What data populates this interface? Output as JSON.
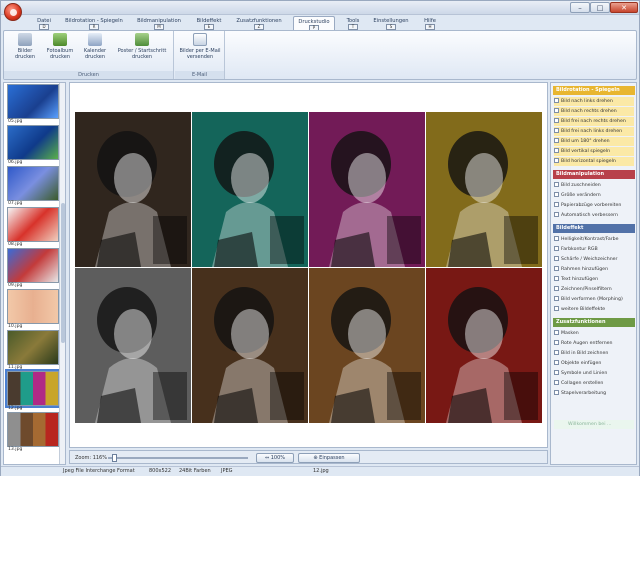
{
  "tabs": [
    {
      "label": "Datei",
      "key": "D"
    },
    {
      "label": "Bildrotation - Spiegeln",
      "key": "R"
    },
    {
      "label": "Bildmanipulation",
      "key": "M"
    },
    {
      "label": "Bildeffekt",
      "key": "E"
    },
    {
      "label": "Zusatzfunktionen",
      "key": "Z"
    },
    {
      "label": "Druckstudio",
      "key": "P"
    },
    {
      "label": "Tools",
      "key": "T"
    },
    {
      "label": "Einstellungen",
      "key": "S"
    },
    {
      "label": "Hilfe",
      "key": "H"
    }
  ],
  "ribbon": {
    "groups": [
      {
        "label": "Drucken",
        "buttons": [
          {
            "label": "Bilder drucken",
            "icon": "printer-icon"
          },
          {
            "label": "Fotoalbum drucken",
            "icon": "album-icon"
          },
          {
            "label": "Kalender drucken",
            "icon": "calendar-icon"
          },
          {
            "label": "Poster / Startschritt drucken",
            "icon": "poster-icon"
          }
        ]
      },
      {
        "label": "E-Mail",
        "buttons": [
          {
            "label": "Bilder per E-Mail versenden",
            "icon": "email-icon"
          }
        ]
      }
    ]
  },
  "thumbnails": [
    {
      "label": "05.jpg"
    },
    {
      "label": "06.jpg"
    },
    {
      "label": "07.jpg"
    },
    {
      "label": "08.jpg"
    },
    {
      "label": "09.jpg"
    },
    {
      "label": "10.jpg"
    },
    {
      "label": "11.jpg"
    },
    {
      "label": "12.jpg"
    },
    {
      "label": "13.jpg"
    }
  ],
  "zoom": {
    "label": "Zoom: 116%",
    "btn_100": "100%",
    "btn_fit": "Einpassen"
  },
  "panel": {
    "sections": [
      {
        "title": "Bildrotation - Spiegeln",
        "color": "#e8b630",
        "items": [
          "Bild nach links drehen",
          "Bild nach rechts drehen",
          "Bild frei nach rechts drehen",
          "Bild frei nach links drehen",
          "Bild um 180° drehen",
          "Bild vertikal spiegeln",
          "Bild horizontal spiegeln"
        ]
      },
      {
        "title": "Bildmanipulation",
        "color": "#b8404a",
        "items": [
          "Bild zuschneiden",
          "Größe verändern",
          "Papierabzüge vorbereiten",
          "Automatisch verbessern"
        ]
      },
      {
        "title": "Bildeffekt",
        "color": "#5272a8",
        "items": [
          "Helligkeit/Kontrast/Farbe",
          "Farbkontur RGB",
          "Schärfe / Weichzeichner",
          "Rahmen hinzufügen",
          "Text hinzufügen",
          "Zeichnen/Pinselfiltern",
          "Bild verformen (Morphing)",
          "weitere Bildeffekte"
        ]
      },
      {
        "title": "Zusatzfunktionen",
        "color": "#6e9a45",
        "items": [
          "Masken",
          "Rote Augen entfernen",
          "Bild in Bild zeichnen",
          "Objekte einfügen",
          "Symbole und Linien",
          "Collagen erstellen",
          "Stapelverarbeitung"
        ]
      }
    ],
    "footer": "Willkommen bei ..."
  },
  "status": {
    "format": "Jpeg File Interchange Format",
    "size": "800x522",
    "depth": "24Bit Farben",
    "type": "JPEG",
    "file": "12.jpg"
  },
  "colors": {
    "accent": "#4a7fd0",
    "tile_tints": [
      "#4a3b2f",
      "#1f9c8a",
      "#b02a86",
      "#c8a52a",
      "#8f8f8f",
      "#6e4a2c",
      "#a56a32",
      "#b8261f"
    ]
  }
}
